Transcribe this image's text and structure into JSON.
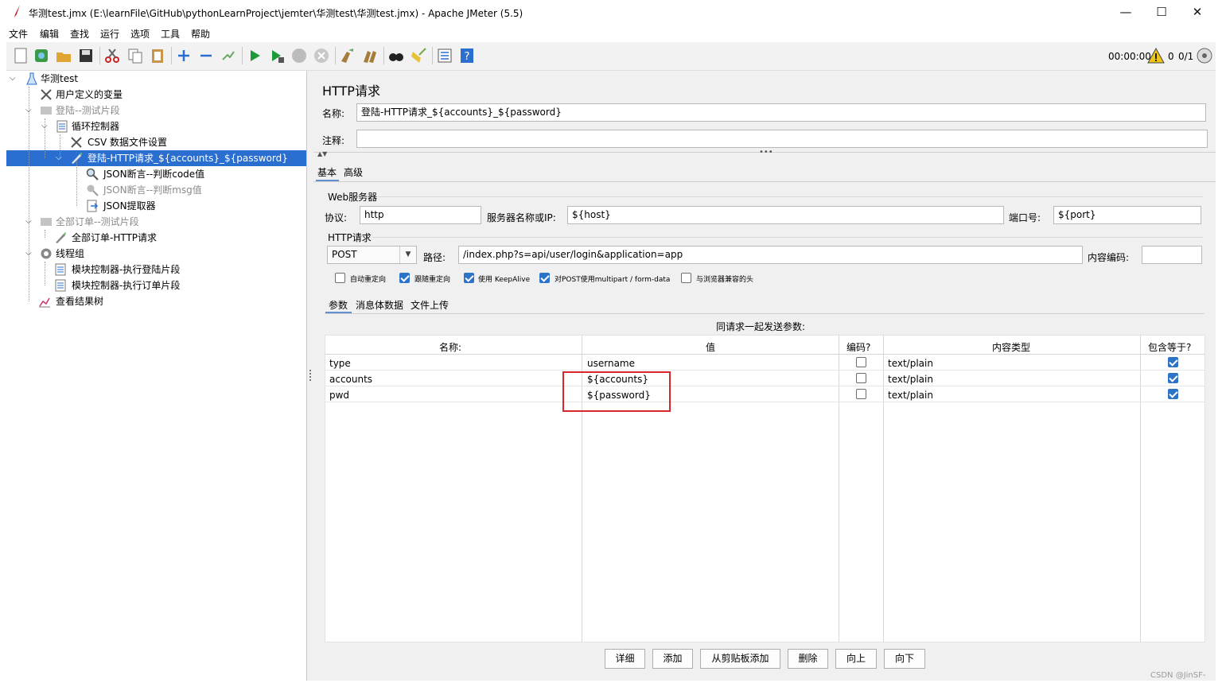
{
  "window": {
    "title": "华测test.jmx (E:\\learnFile\\GitHub\\pythonLearnProject\\jemter\\华测test\\华测test.jmx) - Apache JMeter (5.5)",
    "minimize": "—",
    "maximize": "☐",
    "close": "✕"
  },
  "menu": [
    "文件",
    "编辑",
    "查找",
    "运行",
    "选项",
    "工具",
    "帮助"
  ],
  "toolbar": {
    "timer": "00:00:00",
    "warnings": "0",
    "threads": "0/1"
  },
  "tree": {
    "root": "华测test",
    "user_vars": "用户定义的变量",
    "fragment_login": "登陆--测试片段",
    "loop_controller": "循环控制器",
    "csv_config": "CSV 数据文件设置",
    "http_login": "登陆-HTTP请求_${accounts}_${password}",
    "json_assert_code": "JSON断言--判断code值",
    "json_assert_msg": "JSON断言--判断msg值",
    "json_extractor": "JSON提取器",
    "fragment_orders": "全部订单--测试片段",
    "http_orders": "全部订单-HTTP请求",
    "thread_group": "线程组",
    "module_login": "模块控制器-执行登陆片段",
    "module_orders": "模块控制器-执行订单片段",
    "result_tree": "查看结果树"
  },
  "panel": {
    "heading": "HTTP请求",
    "name_label": "名称:",
    "name_value": "登陆-HTTP请求_${accounts}_${password}",
    "comment_label": "注释:",
    "comment_value": "",
    "tabs": [
      "基本",
      "高级"
    ],
    "web_server_section": "Web服务器",
    "protocol_label": "协议:",
    "protocol_value": "http",
    "server_label": "服务器名称或IP:",
    "server_value": "${host}",
    "port_label": "端口号:",
    "port_value": "${port}",
    "http_section": "HTTP请求",
    "method_value": "POST",
    "path_label": "路径:",
    "path_value": "/index.php?s=api/user/login&application=app",
    "encoding_label": "内容编码:",
    "encoding_value": "",
    "options": [
      {
        "label": "自动重定向",
        "checked": false
      },
      {
        "label": "跟随重定向",
        "checked": true
      },
      {
        "label": "使用 KeepAlive",
        "checked": true
      },
      {
        "label": "对POST使用multipart / form-data",
        "checked": true
      },
      {
        "label": "与浏览器兼容的头",
        "checked": false
      }
    ],
    "sub_tabs": [
      "参数",
      "消息体数据",
      "文件上传"
    ],
    "params_caption": "同请求一起发送参数:",
    "columns": [
      "名称:",
      "值",
      "编码?",
      "内容类型",
      "包含等于?"
    ],
    "rows": [
      {
        "name": "type",
        "value": "username",
        "encode": false,
        "content_type": "text/plain",
        "include_equals": true
      },
      {
        "name": "accounts",
        "value": "${accounts}",
        "encode": false,
        "content_type": "text/plain",
        "include_equals": true
      },
      {
        "name": "pwd",
        "value": "${password}",
        "encode": false,
        "content_type": "text/plain",
        "include_equals": true
      }
    ],
    "buttons": [
      "详细",
      "添加",
      "从剪贴板添加",
      "删除",
      "向上",
      "向下"
    ],
    "highlight_color": "#d9262b"
  },
  "watermark": "CSDN @JinSF-"
}
